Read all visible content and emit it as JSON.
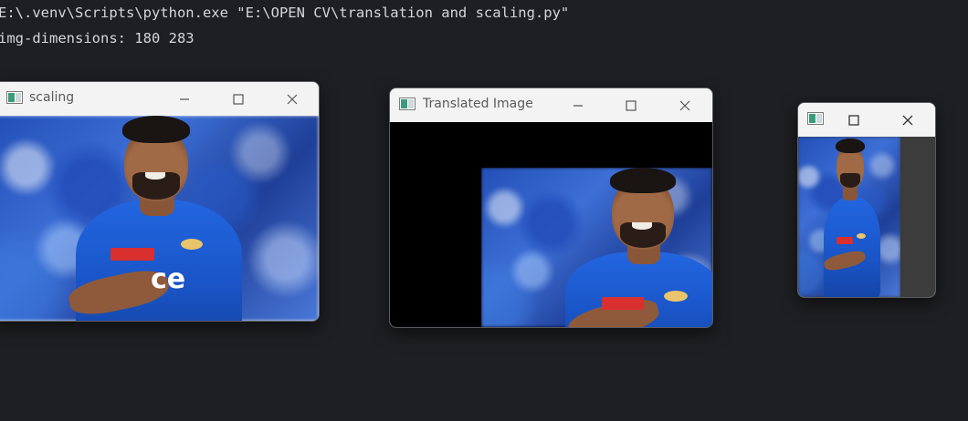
{
  "terminal": {
    "line1": "E:\\.venv\\Scripts\\python.exe \"E:\\OPEN CV\\translation and scaling.py\"",
    "line2": "img-dimensions: 180 283"
  },
  "windows": {
    "scaling": {
      "title": "scaling"
    },
    "translated": {
      "title": "Translated Image"
    },
    "small": {
      "title": ""
    }
  },
  "photo": {
    "chest_text": "ce"
  },
  "colors": {
    "terminal_bg": "#1e1f22",
    "terminal_text": "#d4d6da",
    "titlebar": "#f3f3f3",
    "jersey_blue": "#1a55c8"
  },
  "icons": {
    "app": "opencv-window-icon",
    "minimize": "minimize-icon",
    "maximize": "maximize-icon",
    "close": "close-icon"
  }
}
